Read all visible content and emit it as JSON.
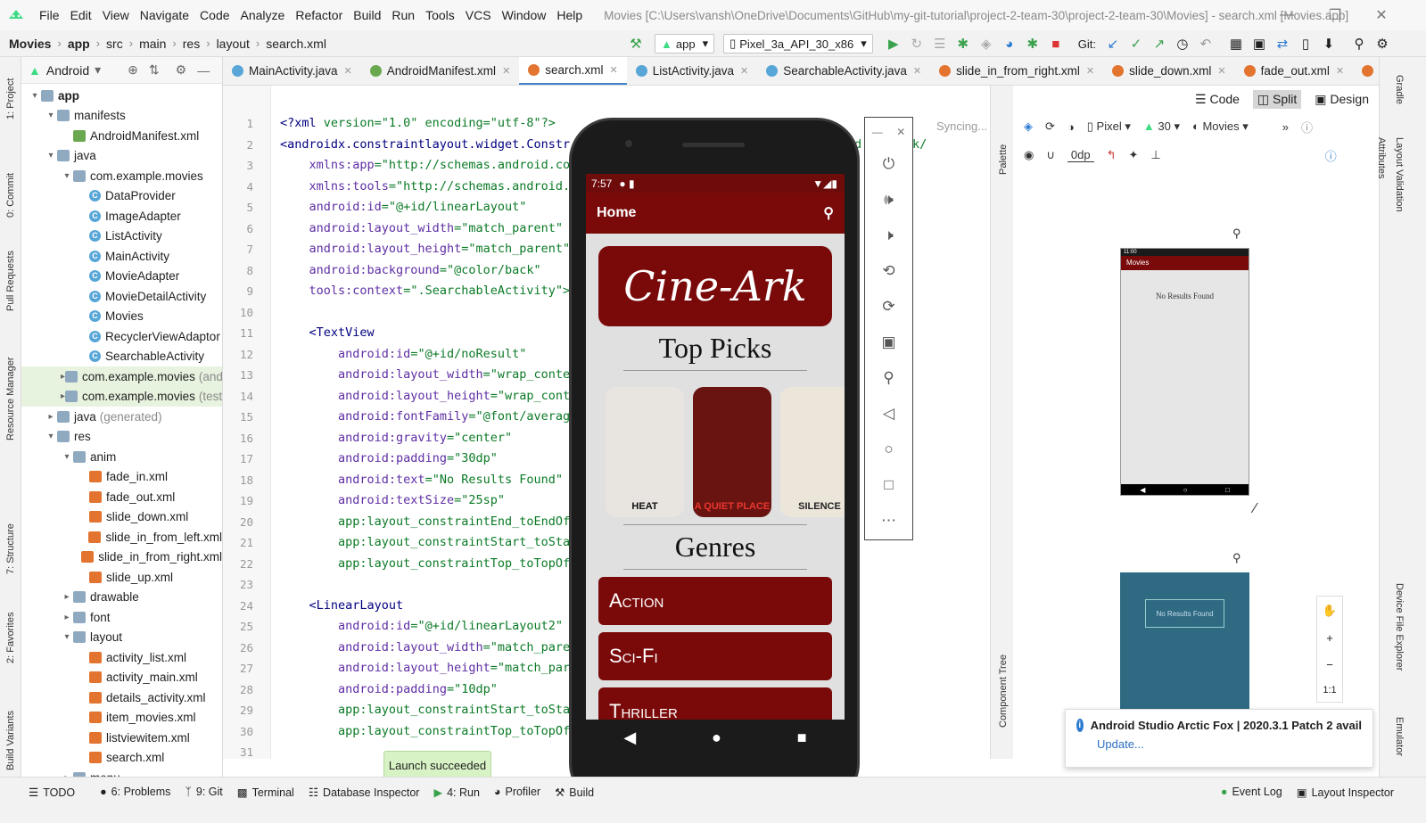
{
  "menubar": {
    "items": [
      "File",
      "Edit",
      "View",
      "Navigate",
      "Code",
      "Analyze",
      "Refactor",
      "Build",
      "Run",
      "Tools",
      "VCS",
      "Window",
      "Help"
    ],
    "window_title": "Movies [C:\\Users\\vansh\\OneDrive\\Documents\\GitHub\\my-git-tutorial\\project-2-team-30\\project-2-team-30\\Movies] - search.xml [Movies.app]"
  },
  "navbar": {
    "breadcrumb": [
      "Movies",
      "app",
      "src",
      "main",
      "res",
      "layout",
      "search.xml"
    ],
    "run_config": "app",
    "device": "Pixel_3a_API_30_x86",
    "git_label": "Git:"
  },
  "left_strip": [
    "1: Project",
    "0: Commit",
    "Pull Requests",
    "Resource Manager",
    "7: Structure",
    "2: Favorites",
    "Build Variants"
  ],
  "project": {
    "view": "Android",
    "tree": [
      {
        "label": "app",
        "depth": 0,
        "kind": "folder",
        "open": true,
        "bold": true
      },
      {
        "label": "manifests",
        "depth": 1,
        "kind": "folder",
        "open": true
      },
      {
        "label": "AndroidManifest.xml",
        "depth": 2,
        "kind": "manifest"
      },
      {
        "label": "java",
        "depth": 1,
        "kind": "folder",
        "open": true
      },
      {
        "label": "com.example.movies",
        "depth": 2,
        "kind": "folder",
        "open": true
      },
      {
        "label": "DataProvider",
        "depth": 3,
        "kind": "class"
      },
      {
        "label": "ImageAdapter",
        "depth": 3,
        "kind": "class"
      },
      {
        "label": "ListActivity",
        "depth": 3,
        "kind": "class"
      },
      {
        "label": "MainActivity",
        "depth": 3,
        "kind": "class"
      },
      {
        "label": "MovieAdapter",
        "depth": 3,
        "kind": "class"
      },
      {
        "label": "MovieDetailActivity",
        "depth": 3,
        "kind": "class"
      },
      {
        "label": "Movies",
        "depth": 3,
        "kind": "class"
      },
      {
        "label": "RecyclerViewAdaptor",
        "depth": 3,
        "kind": "class"
      },
      {
        "label": "SearchableActivity",
        "depth": 3,
        "kind": "class"
      },
      {
        "label": "com.example.movies",
        "hint": "(andr",
        "depth": 2,
        "kind": "folder",
        "sel": true
      },
      {
        "label": "com.example.movies",
        "hint": "(test)",
        "depth": 2,
        "kind": "folder",
        "sel": true
      },
      {
        "label": "java",
        "hint": "(generated)",
        "depth": 1,
        "kind": "folder"
      },
      {
        "label": "res",
        "depth": 1,
        "kind": "folder",
        "open": true
      },
      {
        "label": "anim",
        "depth": 2,
        "kind": "folder",
        "open": true
      },
      {
        "label": "fade_in.xml",
        "depth": 3,
        "kind": "xml"
      },
      {
        "label": "fade_out.xml",
        "depth": 3,
        "kind": "xml"
      },
      {
        "label": "slide_down.xml",
        "depth": 3,
        "kind": "xml"
      },
      {
        "label": "slide_in_from_left.xml",
        "depth": 3,
        "kind": "xml"
      },
      {
        "label": "slide_in_from_right.xml",
        "depth": 3,
        "kind": "xml"
      },
      {
        "label": "slide_up.xml",
        "depth": 3,
        "kind": "xml"
      },
      {
        "label": "drawable",
        "depth": 2,
        "kind": "folder"
      },
      {
        "label": "font",
        "depth": 2,
        "kind": "folder"
      },
      {
        "label": "layout",
        "depth": 2,
        "kind": "folder",
        "open": true
      },
      {
        "label": "activity_list.xml",
        "depth": 3,
        "kind": "xml"
      },
      {
        "label": "activity_main.xml",
        "depth": 3,
        "kind": "xml"
      },
      {
        "label": "details_activity.xml",
        "depth": 3,
        "kind": "xml"
      },
      {
        "label": "item_movies.xml",
        "depth": 3,
        "kind": "xml"
      },
      {
        "label": "listviewitem.xml",
        "depth": 3,
        "kind": "xml"
      },
      {
        "label": "search.xml",
        "depth": 3,
        "kind": "xml"
      },
      {
        "label": "menu",
        "depth": 2,
        "kind": "folder"
      }
    ]
  },
  "tabs": [
    {
      "label": "MainActivity.java",
      "color": "#58a6d8"
    },
    {
      "label": "AndroidManifest.xml",
      "color": "#6aa84f"
    },
    {
      "label": "search.xml",
      "color": "#e3742f",
      "active": true
    },
    {
      "label": "ListActivity.java",
      "color": "#58a6d8"
    },
    {
      "label": "SearchableActivity.java",
      "color": "#58a6d8"
    },
    {
      "label": "slide_in_from_right.xml",
      "color": "#e3742f"
    },
    {
      "label": "slide_down.xml",
      "color": "#e3742f"
    },
    {
      "label": "fade_out.xml",
      "color": "#e3742f"
    },
    {
      "label": "fade_in.xml",
      "color": "#e3742f"
    }
  ],
  "editor": {
    "syncing": "Syncing...",
    "right_fragment": "d.com/apk/",
    "lines": [
      "<?xml version=\"1.0\" encoding=\"utf-8\"?>",
      "<androidx.constraintlayout.widget.Constr",
      "    xmlns:app=\"http://schemas.android.co",
      "    xmlns:tools=\"http://schemas.android.",
      "    android:id=\"@+id/linearLayout\"",
      "    android:layout_width=\"match_parent\"",
      "    android:layout_height=\"match_parent\"",
      "    android:background=\"@color/back\"",
      "    tools:context=\".SearchableActivity\">",
      "",
      "    <TextView",
      "        android:id=\"@+id/noResult\"",
      "        android:layout_width=\"wrap_conte",
      "        android:layout_height=\"wrap_cont",
      "        android:fontFamily=\"@font/averag",
      "        android:gravity=\"center\"",
      "        android:padding=\"30dp\"",
      "        android:text=\"No Results Found\"",
      "        android:textSize=\"25sp\"",
      "        app:layout_constraintEnd_toEndOf",
      "        app:layout_constraintStart_toSta",
      "        app:layout_constraintTop_toTopOf",
      "",
      "    <LinearLayout",
      "        android:id=\"@+id/linearLayout2\"",
      "        android:layout_width=\"match_pare",
      "        android:layout_height=\"match_par",
      "        android:padding=\"10dp\"",
      "        app:layout_constraintStart_toSta",
      "        app:layout_constraintTop_toTopOf",
      ""
    ]
  },
  "phone": {
    "time": "7:57",
    "appbar_title": "Home",
    "logo_text": "Cine-Ark",
    "top_picks": "Top Picks",
    "genres_title": "Genres",
    "genres": [
      "Action",
      "Sci-Fi",
      "Thriller"
    ],
    "posters": [
      {
        "title": "HEAT",
        "color": "#e8e4df",
        "text_color": "#111"
      },
      {
        "title": "A QUIET PLACE",
        "color": "#6a1412",
        "text_color": "#e8372f"
      },
      {
        "title": "SILENCE",
        "color": "#ece6da",
        "text_color": "#222"
      }
    ]
  },
  "design": {
    "modes": [
      "Code",
      "Split",
      "Design"
    ],
    "active_mode": "Split",
    "device": "Pixel",
    "api": "30",
    "theme": "Movies",
    "margin": "0dp",
    "preview_title": "Movies",
    "preview_text": "No Results Found",
    "preview_time": "11:00"
  },
  "right_strip": [
    "Gradle",
    "Attributes",
    "Layout Validation",
    "Device File Explorer",
    "Emulator"
  ],
  "side_labels": {
    "palette": "Palette",
    "component_tree": "Component Tree"
  },
  "bottom": {
    "items": [
      "TODO",
      "6: Problems",
      "9: Git",
      "Terminal",
      "Database Inspector",
      "4: Run",
      "Profiler",
      "Build"
    ],
    "right_items": [
      "Event Log",
      "Layout Inspector"
    ]
  },
  "toast": "Launch succeeded",
  "notification": {
    "title": "Android Studio Arctic Fox | 2020.3.1 Patch 2 avail",
    "link": "Update..."
  }
}
